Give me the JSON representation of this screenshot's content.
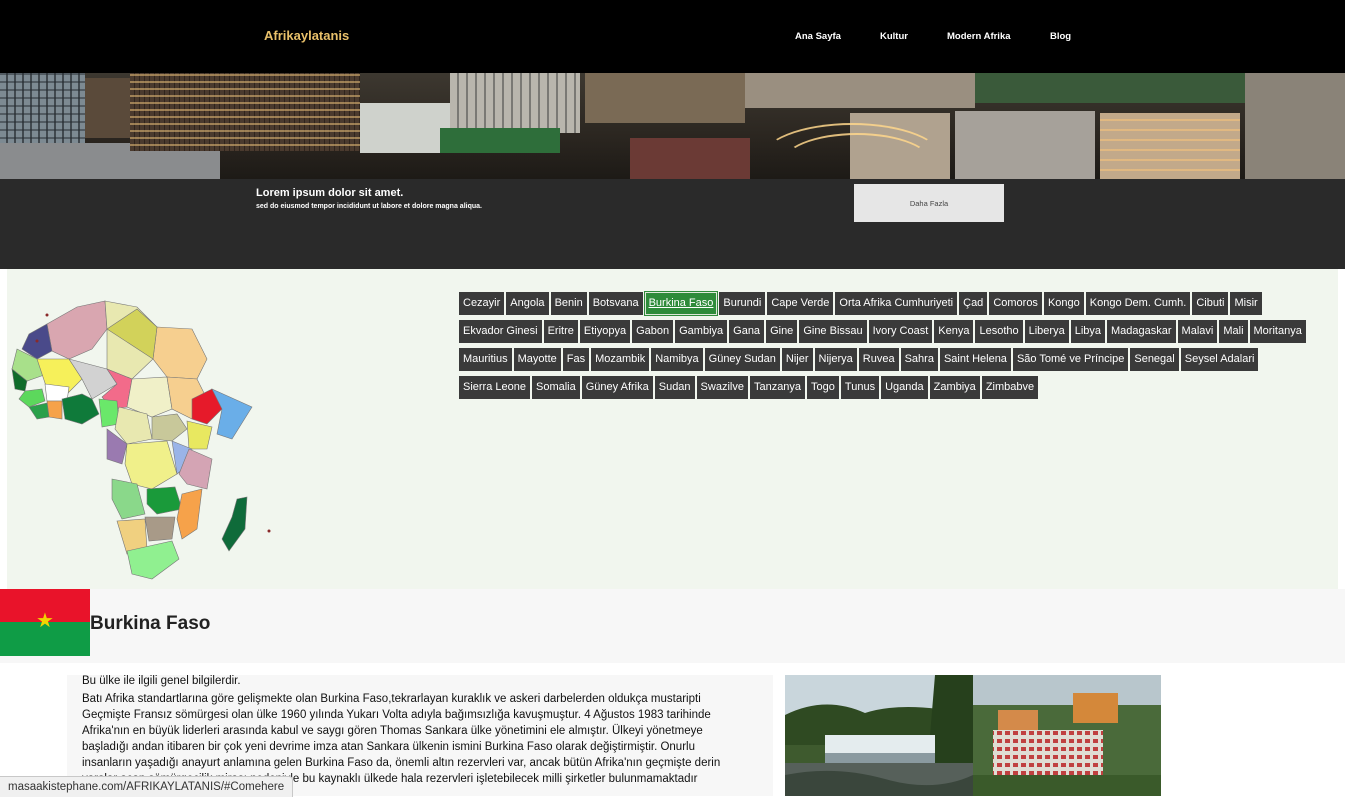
{
  "nav": {
    "brand": "Afrikaylatanis",
    "links": [
      "Ana Sayfa",
      "Kultur",
      "Modern Afrika",
      "Blog"
    ]
  },
  "band": {
    "title": "Lorem ipsum dolor sit amet.",
    "subtitle": "sed do eiusmod tempor incididunt ut labore et dolore magna aliqua.",
    "button": "Daha Fazla"
  },
  "countries": [
    "Cezayir",
    "Angola",
    "Benin",
    "Botsvana",
    "Burkina Faso",
    "Burundi",
    "Cape Verde",
    "Orta Afrika Cumhuriyeti",
    "Çad",
    "Comoros",
    "Kongo",
    "Kongo Dem. Cumh.",
    "Cibuti",
    "Misir",
    "Ekvador Ginesi",
    "Eritre",
    "Etiyopya",
    "Gabon",
    "Gambiya",
    "Gana",
    "Gine",
    "Gine Bissau",
    "Ivory Coast",
    "Kenya",
    "Lesotho",
    "Liberya",
    "Libya",
    "Madagaskar",
    "Malavi",
    "Mali",
    "Moritanya",
    "Mauritius",
    "Mayotte",
    "Fas",
    "Mozambik",
    "Namibya",
    "Güney Sudan",
    "Nijer",
    "Nijerya",
    "Ruvea",
    "Sahra",
    "Saint Helena",
    "São Tomé ve Príncipe",
    "Senegal",
    "Seysel Adalari",
    "Sierra Leone",
    "Somalia",
    "Güney Afrika",
    "Sudan",
    "Swazilve",
    "Tanzanya",
    "Togo",
    "Tunus",
    "Uganda",
    "Zambiya",
    "Zimbabve"
  ],
  "selected_country": "Burkina Faso",
  "country": {
    "name": "Burkina Faso",
    "info_title": "Bu ülke ile ilgili genel bilgilerdir.",
    "info_lines": [
      "Batı Afrika standartlarına göre gelişmekte olan Burkina Faso,tekrarlayan kuraklık ve askeri darbelerden oldukça mustaripti",
      "Geçmişte Fransız sömürgesi olan ülke 1960 yılında Yukarı Volta adıyla bağımsızlığa kavuşmuştur. 4 Ağustos 1983 tarihinde",
      "Afrika'nın en büyük liderleri arasında kabul ve saygı gören Thomas Sankara ülke yönetimini ele almıştır. Ülkeyi yönetmeye",
      "başladığı andan itibaren bir çok yeni devrime imza atan Sankara ülkenin ismini Burkina Faso olarak değiştirmiştir. Onurlu",
      "insanların yaşadığı anayurt anlamına gelen Burkina Faso da, önemli altın rezervleri var, ancak bütün Afrika'nın geçmişte derin",
      "yaralar açan sömürgecilik mirası nedeniyle bu kaynaklı ülkede hala rezervleri işletebilecek milli şirketler bulunmamaktadır"
    ]
  },
  "status_url": "masaakistephane.com/AFRIKAYLATANIS/#Comehere",
  "colors": {
    "brand": "#e8c06a",
    "tag_bg": "#3a3a3a",
    "tag_active": "#2e8b3a",
    "panel_bg": "#f1f6ee"
  }
}
